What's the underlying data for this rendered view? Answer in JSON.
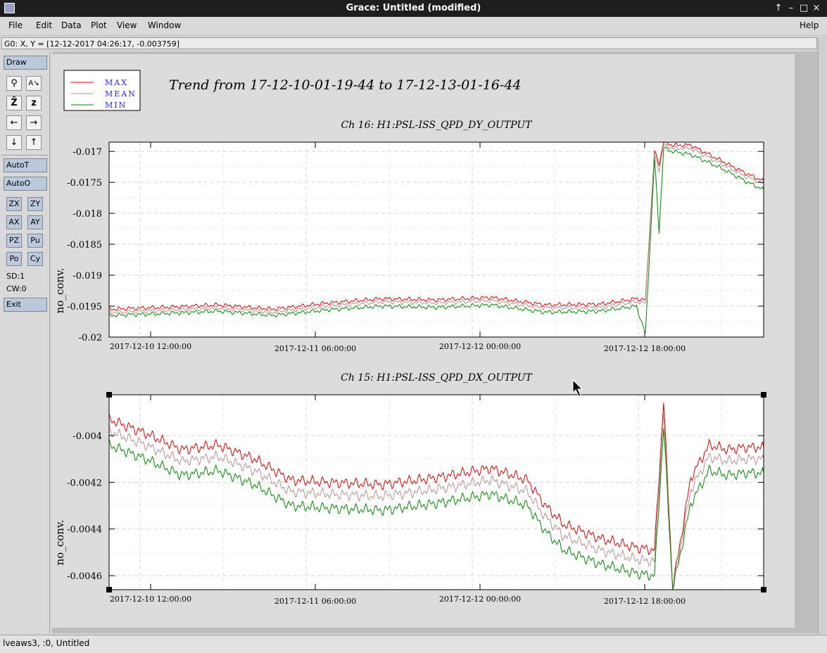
{
  "window": {
    "title": "Grace: Untitled (modified)",
    "controls": [
      "↑",
      "–",
      "□",
      "×"
    ]
  },
  "menubar": {
    "file": "File",
    "edit": "Edit",
    "data": "Data",
    "plot": "Plot",
    "view": "View",
    "window": "Window",
    "help": "Help"
  },
  "location": "G0: X, Y = [12-12-2017 04:26:17, -0.003759]",
  "toolbar": {
    "draw": "Draw",
    "autot": "AutoT",
    "autoo": "AutoO",
    "zx": "ZX",
    "zy": "ZY",
    "ax": "AX",
    "ay": "AY",
    "pz": "PZ",
    "pu": "Pu",
    "po": "Po",
    "cy": "Cy",
    "sd": "SD:1",
    "cw": "CW:0",
    "exit": "Exit",
    "icons": [
      "zoom-icon",
      "autoscale-text-icon",
      "zoom-z-icon",
      "z-icon",
      "arrow-left-icon",
      "arrow-right-icon",
      "arrow-down-icon",
      "arrow-up-icon"
    ]
  },
  "status": "lveaws3, :0, Untitled",
  "colors": {
    "max": "#e00000",
    "mean": "#b89090",
    "min": "#008a00"
  },
  "chart_data": [
    {
      "type": "line",
      "title": "Trend from 17-12-10-01-19-44 to 17-12-13-01-16-44",
      "subtitle": "Ch 16: H1:PSL-ISS_QPD_DY_OUTPUT",
      "ylabel": "no_conv.",
      "xlabel": "",
      "legend": [
        "MAX",
        "MEAN",
        "MIN"
      ],
      "legend_position": "top-left",
      "x_ticks": [
        "2017-12-10 12:00:00",
        "2017-12-11 06:00:00",
        "2017-12-12 00:00:00",
        "2017-12-12 18:00:00"
      ],
      "y_ticks": [
        "-0.017",
        "-0.0175",
        "-0.018",
        "-0.0185",
        "-0.019",
        "-0.0195",
        "-0.02"
      ],
      "ylim": [
        -0.02,
        -0.01685
      ],
      "grid": true,
      "series": [
        {
          "name": "MAX",
          "x_hours": [
            0,
            6,
            12,
            18,
            24,
            30,
            36,
            42,
            48,
            54,
            58,
            59,
            60,
            60.5,
            61,
            62,
            64,
            66,
            68,
            70,
            72
          ],
          "values": [
            -0.01955,
            -0.01952,
            -0.01948,
            -0.01955,
            -0.01945,
            -0.01938,
            -0.0194,
            -0.01936,
            -0.01948,
            -0.01947,
            -0.01938,
            -0.0194,
            -0.017,
            -0.0172,
            -0.01685,
            -0.0169,
            -0.0169,
            -0.01705,
            -0.0172,
            -0.01735,
            -0.01748
          ]
        },
        {
          "name": "MEAN",
          "x_hours": [
            0,
            6,
            12,
            18,
            24,
            30,
            36,
            42,
            48,
            54,
            58,
            59,
            60,
            60.5,
            61,
            62,
            64,
            66,
            68,
            70,
            72
          ],
          "values": [
            -0.0196,
            -0.01957,
            -0.01953,
            -0.0196,
            -0.0195,
            -0.01943,
            -0.01945,
            -0.01941,
            -0.01953,
            -0.01952,
            -0.01943,
            -0.01945,
            -0.01705,
            -0.0173,
            -0.0169,
            -0.01695,
            -0.01695,
            -0.0171,
            -0.01725,
            -0.0174,
            -0.01753
          ]
        },
        {
          "name": "MIN",
          "x_hours": [
            0,
            6,
            12,
            18,
            24,
            30,
            36,
            42,
            48,
            54,
            58,
            59,
            60,
            60.5,
            61,
            62,
            64,
            66,
            68,
            70,
            72
          ],
          "values": [
            -0.01965,
            -0.01962,
            -0.01958,
            -0.01965,
            -0.01956,
            -0.0195,
            -0.01952,
            -0.01948,
            -0.0196,
            -0.01958,
            -0.0195,
            -0.01995,
            -0.0171,
            -0.0183,
            -0.01695,
            -0.017,
            -0.01705,
            -0.01718,
            -0.01732,
            -0.01748,
            -0.01762
          ]
        }
      ]
    },
    {
      "type": "line",
      "subtitle": "Ch 15: H1:PSL-ISS_QPD_DX_OUTPUT",
      "ylabel": "no_conv.",
      "xlabel": "",
      "x_ticks": [
        "2017-12-10 12:00:00",
        "2017-12-11 06:00:00",
        "2017-12-12 00:00:00",
        "2017-12-12 18:00:00"
      ],
      "y_ticks": [
        "-0.004",
        "-0.0042",
        "-0.0044",
        "-0.0046"
      ],
      "ylim": [
        -0.00466,
        -0.003825
      ],
      "grid": true,
      "series": [
        {
          "name": "MAX",
          "x_hours": [
            0,
            4,
            8,
            12,
            16,
            20,
            24,
            30,
            36,
            42,
            46,
            48,
            50,
            54,
            58,
            60,
            61,
            62,
            64,
            66,
            68,
            70,
            72
          ],
          "values": [
            -0.00393,
            -0.00399,
            -0.00406,
            -0.00404,
            -0.0041,
            -0.00419,
            -0.0042,
            -0.00421,
            -0.00418,
            -0.00414,
            -0.00419,
            -0.0043,
            -0.00438,
            -0.00444,
            -0.00448,
            -0.00449,
            -0.00385,
            -0.00465,
            -0.00418,
            -0.00404,
            -0.00406,
            -0.00405,
            -0.00405
          ]
        },
        {
          "name": "MEAN",
          "x_hours": [
            0,
            4,
            8,
            12,
            16,
            20,
            24,
            30,
            36,
            42,
            46,
            48,
            50,
            54,
            58,
            60,
            61,
            62,
            64,
            66,
            68,
            70,
            72
          ],
          "values": [
            -0.00398,
            -0.00404,
            -0.00411,
            -0.00409,
            -0.00415,
            -0.00424,
            -0.00425,
            -0.00426,
            -0.00423,
            -0.00419,
            -0.00424,
            -0.00435,
            -0.00443,
            -0.00449,
            -0.00453,
            -0.00454,
            -0.0039,
            -0.00466,
            -0.00423,
            -0.00409,
            -0.00411,
            -0.0041,
            -0.0041
          ]
        },
        {
          "name": "MIN",
          "x_hours": [
            0,
            4,
            8,
            12,
            16,
            20,
            24,
            30,
            36,
            42,
            46,
            48,
            50,
            54,
            58,
            60,
            61,
            62,
            64,
            66,
            68,
            70,
            72
          ],
          "values": [
            -0.00404,
            -0.0041,
            -0.00417,
            -0.00415,
            -0.00421,
            -0.0043,
            -0.00431,
            -0.00432,
            -0.00429,
            -0.00425,
            -0.0043,
            -0.00441,
            -0.00449,
            -0.00455,
            -0.00459,
            -0.0046,
            -0.00396,
            -0.00466,
            -0.00429,
            -0.00415,
            -0.00417,
            -0.00416,
            -0.00416
          ]
        }
      ]
    }
  ]
}
